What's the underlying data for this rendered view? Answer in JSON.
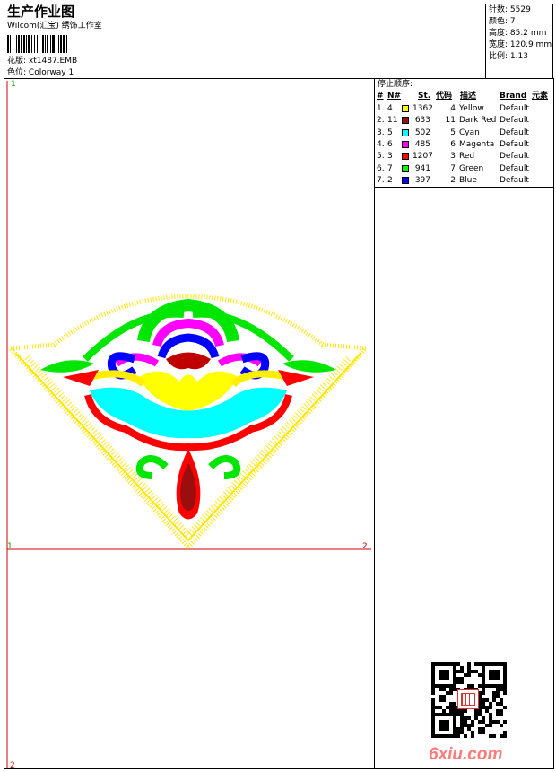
{
  "header": {
    "title": "生产作业图",
    "subtitle": "Wilcom(汇宝) 绣饰工作室",
    "design_label": "花版:",
    "design_value": "xt1487.EMB",
    "colorway_label": "色位:",
    "colorway_value": "Colorway 1"
  },
  "stats": [
    {
      "label": "针数:",
      "value": "5529"
    },
    {
      "label": "颜色:",
      "value": "7"
    },
    {
      "label": "高度:",
      "value": "85.2 mm"
    },
    {
      "label": "宽度:",
      "value": "120.9 mm"
    },
    {
      "label": "比例:",
      "value": "1.13"
    }
  ],
  "legend": {
    "title": "停止顺序:",
    "headers": {
      "seq": "#",
      "num": "N#",
      "st": "St.",
      "code": "代码",
      "desc": "描述",
      "brand": "Brand",
      "elem": "元素"
    },
    "rows": [
      {
        "seq": "1.",
        "num": "4",
        "color": "#ffff00",
        "st": "1362",
        "code": "4",
        "desc": "Yellow",
        "brand": "Default"
      },
      {
        "seq": "2.",
        "num": "11",
        "color": "#9a0e0e",
        "st": "633",
        "code": "11",
        "desc": "Dark Red",
        "brand": "Default"
      },
      {
        "seq": "3.",
        "num": "5",
        "color": "#00ffff",
        "st": "502",
        "code": "5",
        "desc": "Cyan",
        "brand": "Default"
      },
      {
        "seq": "4.",
        "num": "6",
        "color": "#ff00ff",
        "st": "485",
        "code": "6",
        "desc": "Magenta",
        "brand": "Default"
      },
      {
        "seq": "5.",
        "num": "3",
        "color": "#ff0000",
        "st": "1207",
        "code": "3",
        "desc": "Red",
        "brand": "Default"
      },
      {
        "seq": "6.",
        "num": "7",
        "color": "#00ff00",
        "st": "941",
        "code": "7",
        "desc": "Green",
        "brand": "Default"
      },
      {
        "seq": "7.",
        "num": "2",
        "color": "#0000ff",
        "st": "397",
        "code": "2",
        "desc": "Blue",
        "brand": "Default"
      }
    ]
  },
  "markers": {
    "top_left": "1",
    "mid_left": "1",
    "mid_right": "2",
    "bottom_left": "2"
  },
  "watermark": {
    "logo": "6xiu.com"
  },
  "icons": {
    "qr": "qr-code-icon",
    "seal": "seal-stamp-icon"
  }
}
